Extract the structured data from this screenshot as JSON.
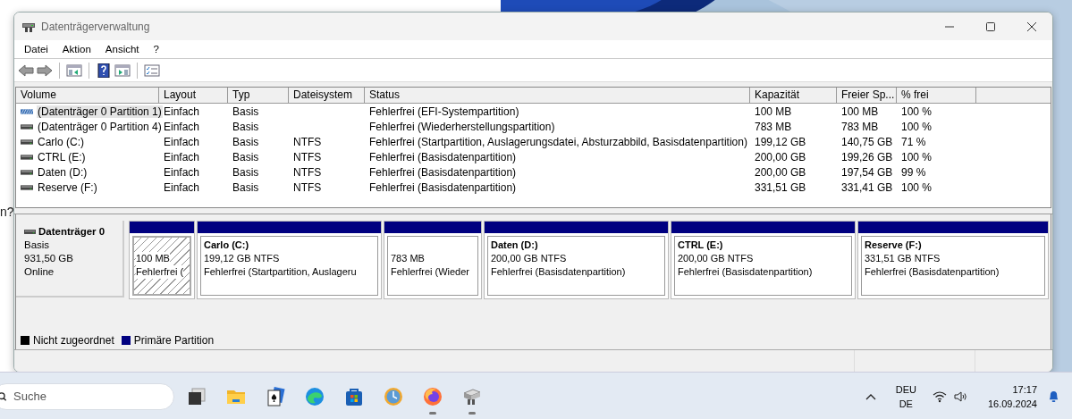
{
  "background": {
    "texts": [
      "n?"
    ]
  },
  "window": {
    "title": "Datenträgerverwaltung"
  },
  "menu": [
    "Datei",
    "Aktion",
    "Ansicht",
    "?"
  ],
  "toolbar": [
    {
      "kind": "back"
    },
    {
      "kind": "forward"
    },
    {
      "kind": "sep"
    },
    {
      "kind": "tree"
    },
    {
      "kind": "sep"
    },
    {
      "kind": "help"
    },
    {
      "kind": "panel"
    },
    {
      "kind": "sep"
    },
    {
      "kind": "props"
    }
  ],
  "volumes": {
    "columns": [
      "Volume",
      "Layout",
      "Typ",
      "Dateisystem",
      "Status",
      "Kapazität",
      "Freier Sp...",
      "% frei"
    ],
    "rows": [
      {
        "kind": "efi",
        "selected": true,
        "cells": [
          "(Datenträger 0 Partition 1)",
          "Einfach",
          "Basis",
          "",
          "Fehlerfrei (EFI-Systempartition)",
          "100 MB",
          "100 MB",
          "100 %"
        ]
      },
      {
        "kind": "disk",
        "selected": false,
        "cells": [
          "(Datenträger 0 Partition 4)",
          "Einfach",
          "Basis",
          "",
          "Fehlerfrei (Wiederherstellungspartition)",
          "783 MB",
          "783 MB",
          "100 %"
        ]
      },
      {
        "kind": "disk",
        "selected": false,
        "cells": [
          "Carlo (C:)",
          "Einfach",
          "Basis",
          "NTFS",
          "Fehlerfrei (Startpartition, Auslagerungsdatei, Absturzabbild, Basisdatenpartition)",
          "199,12 GB",
          "140,75 GB",
          "71 %"
        ]
      },
      {
        "kind": "disk",
        "selected": false,
        "cells": [
          "CTRL (E:)",
          "Einfach",
          "Basis",
          "NTFS",
          "Fehlerfrei (Basisdatenpartition)",
          "200,00 GB",
          "199,26 GB",
          "100 %"
        ]
      },
      {
        "kind": "disk",
        "selected": false,
        "cells": [
          "Daten (D:)",
          "Einfach",
          "Basis",
          "NTFS",
          "Fehlerfrei (Basisdatenpartition)",
          "200,00 GB",
          "197,54 GB",
          "99 %"
        ]
      },
      {
        "kind": "disk",
        "selected": false,
        "cells": [
          "Reserve (F:)",
          "Einfach",
          "Basis",
          "NTFS",
          "Fehlerfrei (Basisdatenpartition)",
          "331,51 GB",
          "331,41 GB",
          "100 %"
        ]
      }
    ]
  },
  "disk": {
    "name": "Datenträger 0",
    "type": "Basis",
    "size": "931,50 GB",
    "state": "Online",
    "partitions": [
      {
        "kind": "primary",
        "selected": true,
        "size": "100 MB",
        "status": "Fehlerfrei ("
      },
      {
        "kind": "primary",
        "selected": false,
        "name": "Carlo  (C:)",
        "size": "199,12 GB NTFS",
        "status": "Fehlerfrei (Startpartition, Auslageru"
      },
      {
        "kind": "primary",
        "selected": false,
        "size": "783 MB",
        "status": "Fehlerfrei (Wieder"
      },
      {
        "kind": "primary",
        "selected": false,
        "name": "Daten  (D:)",
        "size": "200,00 GB NTFS",
        "status": "Fehlerfrei (Basisdatenpartition)"
      },
      {
        "kind": "primary",
        "selected": false,
        "name": "CTRL  (E:)",
        "size": "200,00 GB NTFS",
        "status": "Fehlerfrei (Basisdatenpartition)"
      },
      {
        "kind": "primary",
        "selected": false,
        "name": "Reserve  (F:)",
        "size": "331,51 GB NTFS",
        "status": "Fehlerfrei (Basisdatenpartition)"
      }
    ]
  },
  "legend": [
    {
      "label": "Nicht zugeordnet",
      "color": "#000000"
    },
    {
      "label": "Primäre Partition",
      "color": "#000080"
    }
  ],
  "taskbar": {
    "search": {
      "placeholder": "Suche"
    },
    "apps": [
      {
        "kind": "taskview",
        "running": false
      },
      {
        "kind": "folder",
        "running": false
      },
      {
        "kind": "cards",
        "running": false
      },
      {
        "kind": "browser",
        "running": false
      },
      {
        "kind": "store",
        "running": false
      },
      {
        "kind": "clock",
        "running": false
      },
      {
        "kind": "fox",
        "running": true
      },
      {
        "kind": "diskmgmt",
        "running": true
      }
    ],
    "language": [
      "DEU",
      "DE"
    ],
    "time": "17:17",
    "date": "16.09.2024"
  }
}
